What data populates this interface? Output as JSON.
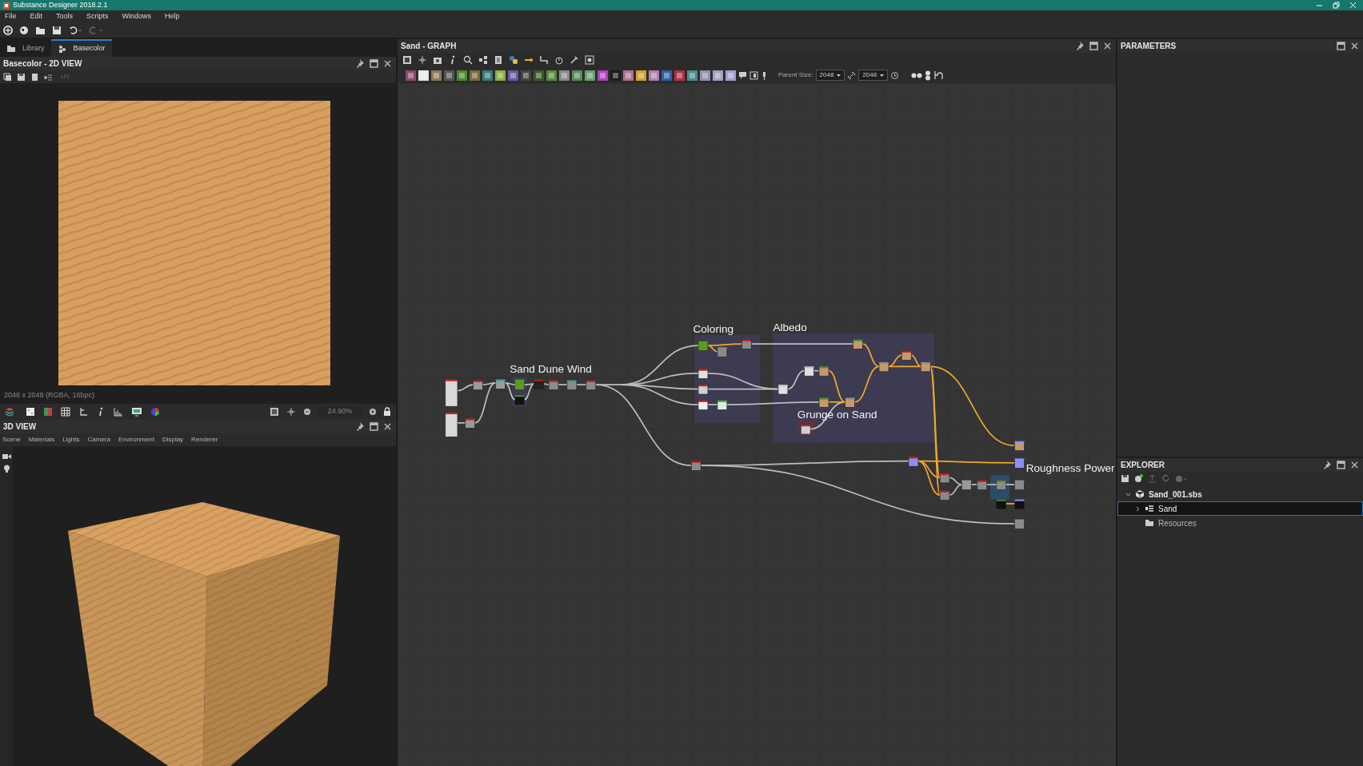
{
  "window": {
    "title": "Substance Designer 2018.2.1"
  },
  "menu": [
    "File",
    "Edit",
    "Tools",
    "Scripts",
    "Windows",
    "Help"
  ],
  "left_tabs": [
    {
      "label": "Library",
      "selected": false
    },
    {
      "label": "Basecolor",
      "selected": true
    }
  ],
  "view_2d": {
    "title": "Basecolor - 2D VIEW",
    "uv_label": "UV",
    "image_info": "2048 x 2048 (RGBA, 16bpc)",
    "zoom": "24.90%"
  },
  "view_3d": {
    "title": "3D VIEW",
    "tabs": [
      "Scene",
      "Materials",
      "Lights",
      "Camera",
      "Environment",
      "Display",
      "Renderer"
    ]
  },
  "graph": {
    "title": "Sand - GRAPH",
    "parent_size_label": "Parent Size:",
    "parent_size": "2048",
    "output_size": "2048",
    "frames": [
      {
        "label": "Sand Dune Wind"
      },
      {
        "label": "Coloring"
      },
      {
        "label": "Albedo"
      },
      {
        "label": "Grunge on Sand"
      },
      {
        "label": "Roughness Power"
      }
    ]
  },
  "parameters": {
    "title": "PARAMETERS"
  },
  "explorer": {
    "title": "EXPLORER",
    "tree": [
      {
        "label": "Sand_001.sbs",
        "kind": "package",
        "expanded": true,
        "selected": false,
        "children": [
          {
            "label": "Sand",
            "kind": "graph",
            "expanded": false,
            "selected": true
          },
          {
            "label": "Resources",
            "kind": "folder",
            "selected": false
          }
        ]
      }
    ]
  }
}
